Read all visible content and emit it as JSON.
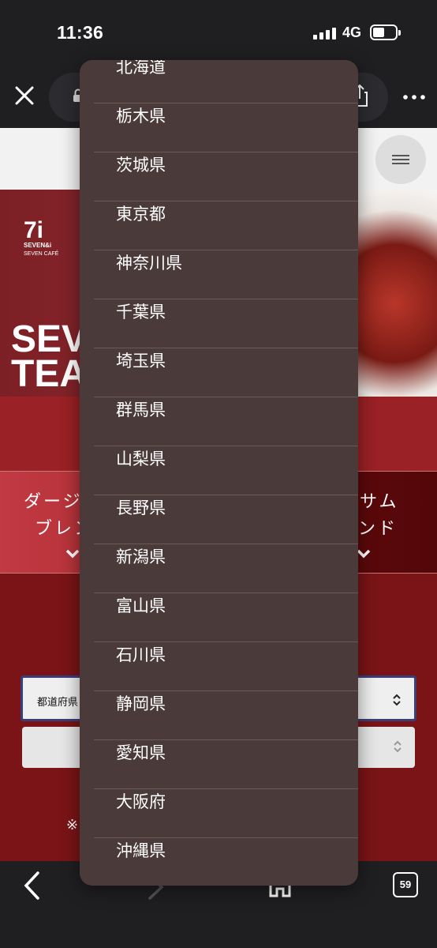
{
  "status_bar": {
    "time": "11:36",
    "network": "4G"
  },
  "site": {
    "logo": {
      "mark": "7i",
      "line1": "SEVEN&i",
      "line2": "SEVEN CAFÉ"
    },
    "hero_title_line1": "SEVEN",
    "hero_title_line2": "TEA"
  },
  "tea_cards": [
    {
      "line1": "ダージ",
      "line2": "ブレン"
    },
    {
      "line1": "サム",
      "line2": "ンド"
    }
  ],
  "prefecture_select": {
    "selected": "都道府県"
  },
  "note_prefix": "※",
  "tab_count": "59",
  "picker": {
    "options": [
      "北海道",
      "栃木県",
      "茨城県",
      "東京都",
      "神奈川県",
      "千葉県",
      "埼玉県",
      "群馬県",
      "山梨県",
      "長野県",
      "新潟県",
      "富山県",
      "石川県",
      "静岡県",
      "愛知県",
      "大阪府",
      "沖縄県"
    ]
  }
}
